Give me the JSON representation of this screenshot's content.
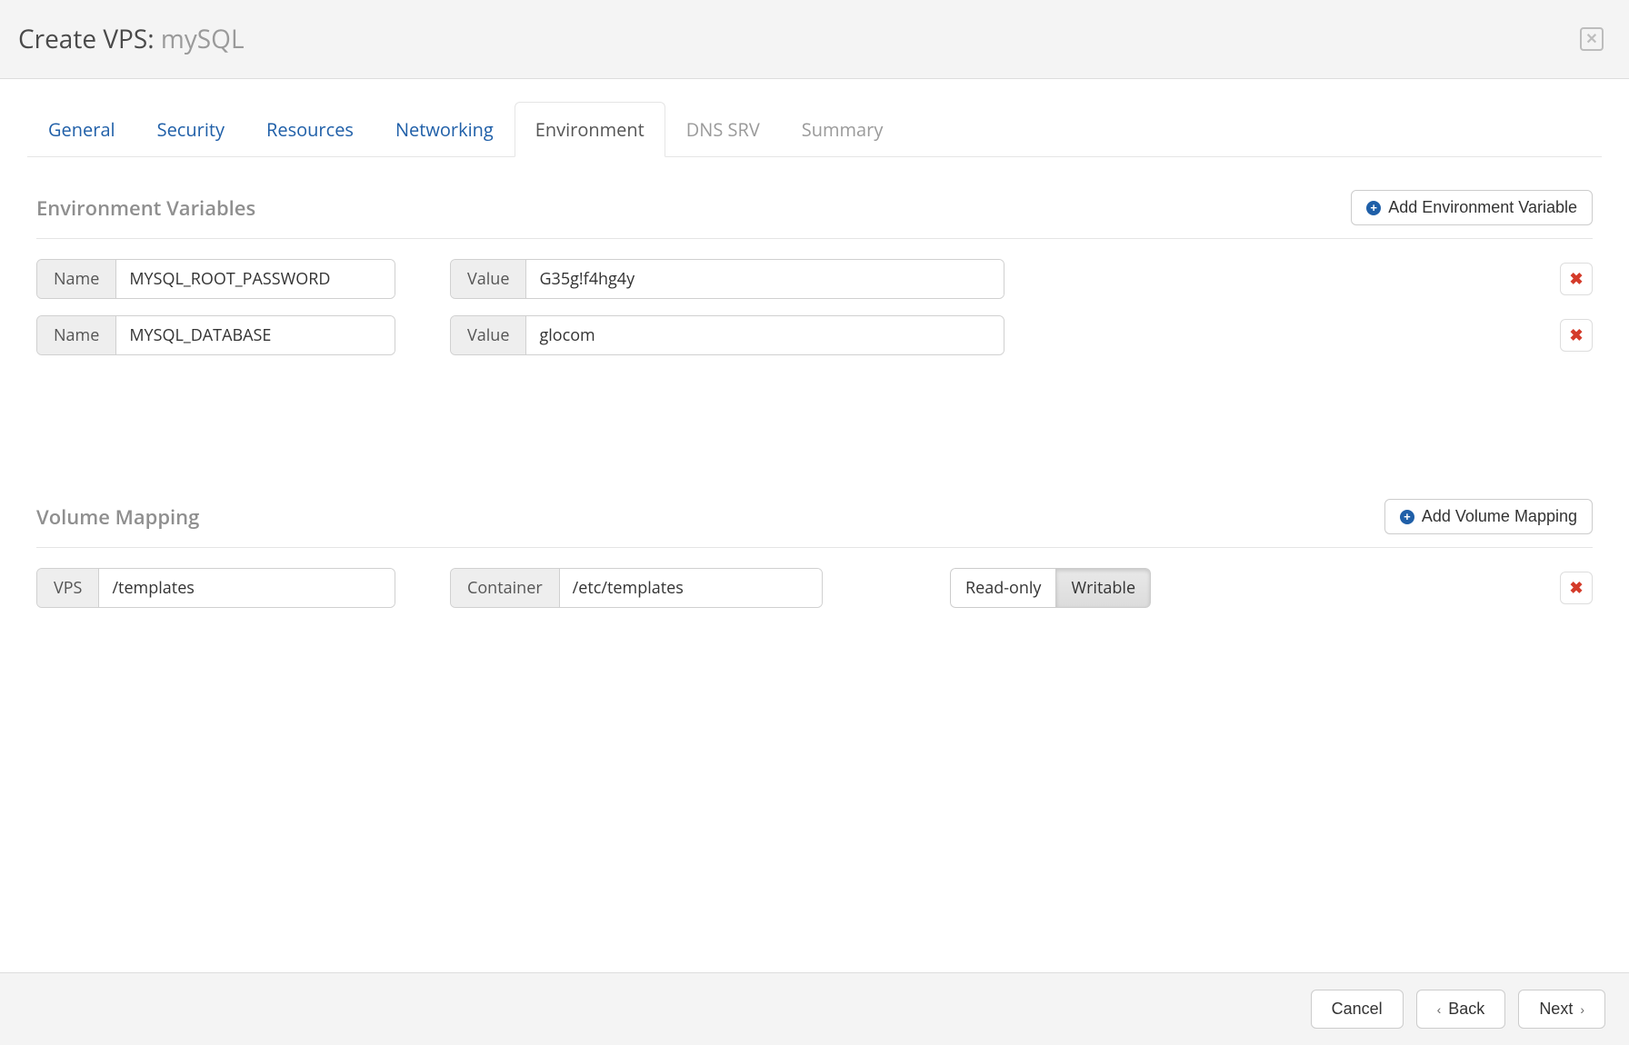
{
  "header": {
    "title_prefix": "Create VPS: ",
    "title_name": "mySQL"
  },
  "tabs": [
    {
      "label": "General",
      "state": "link"
    },
    {
      "label": "Security",
      "state": "link"
    },
    {
      "label": "Resources",
      "state": "link"
    },
    {
      "label": "Networking",
      "state": "link"
    },
    {
      "label": "Environment",
      "state": "active"
    },
    {
      "label": "DNS SRV",
      "state": "disabled"
    },
    {
      "label": "Summary",
      "state": "disabled"
    }
  ],
  "env_section": {
    "title": "Environment Variables",
    "add_label": "Add Environment Variable",
    "name_addon": "Name",
    "value_addon": "Value",
    "rows": [
      {
        "name": "MYSQL_ROOT_PASSWORD",
        "value": "G35g!f4hg4y"
      },
      {
        "name": "MYSQL_DATABASE",
        "value": "glocom"
      }
    ]
  },
  "vol_section": {
    "title": "Volume Mapping",
    "add_label": "Add Volume Mapping",
    "vps_addon": "VPS",
    "container_addon": "Container",
    "readonly_label": "Read-only",
    "writable_label": "Writable",
    "rows": [
      {
        "vps": "/templates",
        "container": "/etc/templates",
        "mode": "writable"
      }
    ]
  },
  "footer": {
    "cancel": "Cancel",
    "back": "Back",
    "next": "Next"
  }
}
